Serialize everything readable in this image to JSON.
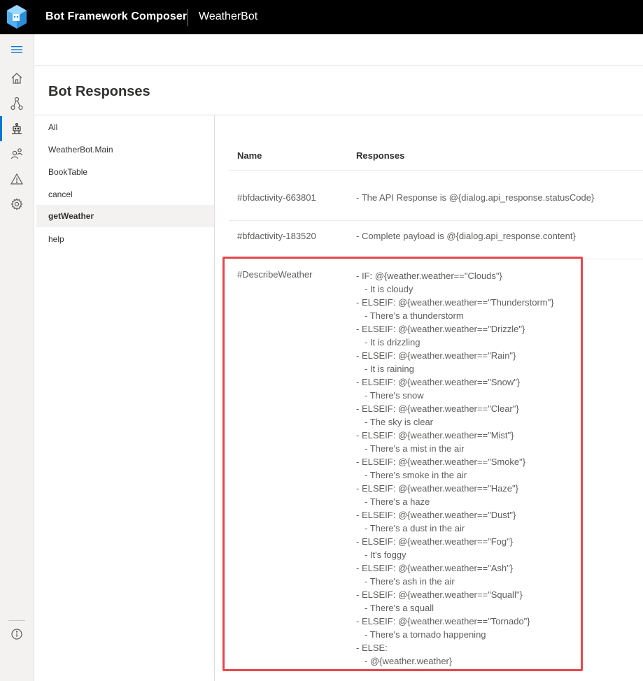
{
  "header": {
    "app_title": "Bot Framework Composer",
    "bot_name": "WeatherBot",
    "logo_icon": "composer-cube-icon"
  },
  "nav_rail": {
    "items": [
      {
        "icon": "hamburger-icon"
      },
      {
        "icon": "home-icon"
      },
      {
        "icon": "design-flow-icon"
      },
      {
        "icon": "bot-responses-icon",
        "active": true
      },
      {
        "icon": "user-input-icon"
      },
      {
        "icon": "notifications-warning-icon"
      },
      {
        "icon": "settings-gear-icon"
      },
      {
        "icon": "info-icon"
      }
    ]
  },
  "page": {
    "title": "Bot Responses"
  },
  "dialogs": {
    "items": [
      {
        "label": "All"
      },
      {
        "label": "WeatherBot.Main"
      },
      {
        "label": "BookTable"
      },
      {
        "label": "cancel"
      },
      {
        "label": "getWeather",
        "selected": true
      },
      {
        "label": "help"
      }
    ]
  },
  "table": {
    "columns": {
      "name": "Name",
      "responses": "Responses"
    },
    "rows": [
      {
        "name": "#bfdactivity-663801",
        "response": "- The API Response is @{dialog.api_response.statusCode}"
      },
      {
        "name": "#bfdactivity-183520",
        "response": "- Complete payload is @{dialog.api_response.content}"
      },
      {
        "name": "#DescribeWeather"
      }
    ],
    "describe_weather_lines": [
      "- IF: @{weather.weather==\"Clouds\"}",
      "- It is cloudy",
      "- ELSEIF: @{weather.weather==\"Thunderstorm\"}",
      "- There's a thunderstorm",
      "- ELSEIF: @{weather.weather==\"Drizzle\"}",
      "- It is drizzling",
      "- ELSEIF: @{weather.weather==\"Rain\"}",
      "- It is raining",
      "- ELSEIF: @{weather.weather==\"Snow\"}",
      "- There's snow",
      "- ELSEIF: @{weather.weather==\"Clear\"}",
      "- The sky is clear",
      "- ELSEIF: @{weather.weather==\"Mist\"}",
      "- There's a mist in the air",
      "- ELSEIF: @{weather.weather==\"Smoke\"}",
      "- There's smoke in the air",
      "- ELSEIF: @{weather.weather==\"Haze\"}",
      "- There's a haze",
      "- ELSEIF: @{weather.weather==\"Dust\"}",
      "- There's a dust in the air",
      "- ELSEIF: @{weather.weather==\"Fog\"}",
      "- It's foggy",
      "- ELSEIF: @{weather.weather==\"Ash\"}",
      "- There's ash in the air",
      "- ELSEIF: @{weather.weather==\"Squall\"}",
      "- There's a squall",
      "- ELSEIF: @{weather.weather==\"Tornado\"}",
      "- There's a tornado happening",
      "- ELSE:",
      "- @{weather.weather}"
    ]
  },
  "colors": {
    "accent": "#0078d4",
    "highlight_border": "#e8474a",
    "header_bg": "#000000"
  }
}
